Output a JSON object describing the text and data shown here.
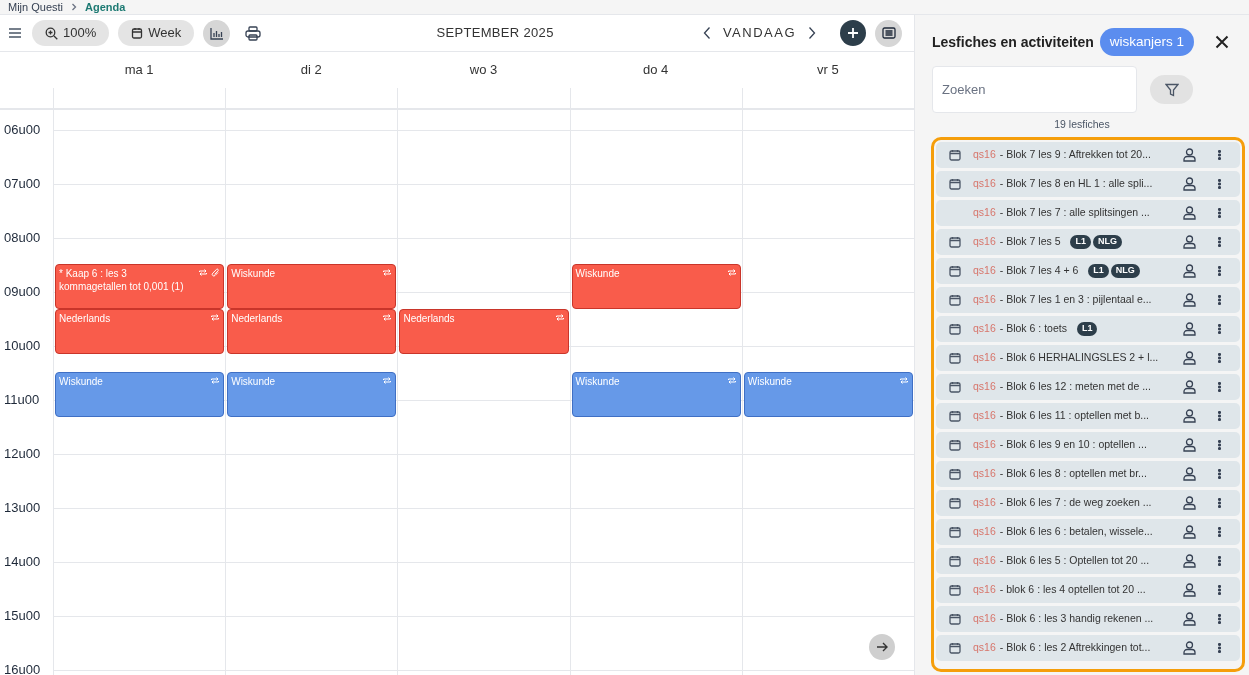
{
  "breadcrumb": [
    {
      "label": "Mijn Questi",
      "selected": false
    },
    {
      "label": "Agenda",
      "selected": true
    }
  ],
  "toolbar": {
    "zoom": "100%",
    "view": "Week",
    "title": "SEPTEMBER 2025",
    "today": "VANDAAG"
  },
  "hours": [
    "06u00",
    "07u00",
    "08u00",
    "09u00",
    "10u00",
    "11u00",
    "12u00",
    "13u00",
    "14u00",
    "15u00",
    "16u00"
  ],
  "days": [
    {
      "label": "ma 1",
      "events": [
        {
          "kind": "lesson",
          "lines": [
            "* Kaap 6 : les 3",
            "kommagetallen tot 0,001 (1)"
          ],
          "color": "#f95c4b",
          "recurring": true,
          "attachment": true
        },
        {
          "kind": "lesson",
          "lines": [
            "Nederlands"
          ],
          "color": "#f95c4b",
          "recurring": true
        },
        {
          "kind": "lesson",
          "lines": [
            "Wiskunde"
          ],
          "color": "#6699e8",
          "recurring": true
        }
      ]
    },
    {
      "label": "di 2",
      "events": [
        {
          "kind": "lesson",
          "lines": [
            "Wiskunde"
          ],
          "color": "#f95c4b",
          "recurring": true
        },
        {
          "kind": "lesson",
          "lines": [
            "Nederlands"
          ],
          "color": "#f95c4b",
          "recurring": true
        },
        {
          "kind": "lesson",
          "lines": [
            "Wiskunde"
          ],
          "color": "#6699e8",
          "recurring": true
        }
      ]
    },
    {
      "label": "wo 3",
      "events": [
        {
          "kind": "empty"
        },
        {
          "kind": "lesson",
          "lines": [
            "Nederlands"
          ],
          "color": "#f95c4b",
          "recurring": true
        }
      ]
    },
    {
      "label": "do 4",
      "events": [
        {
          "kind": "lesson",
          "lines": [
            "Wiskunde"
          ],
          "color": "#f95c4b",
          "recurring": true
        },
        {
          "kind": "empty"
        },
        {
          "kind": "lesson",
          "lines": [
            "Wiskunde"
          ],
          "color": "#6699e8",
          "recurring": true
        }
      ]
    },
    {
      "label": "vr 5",
      "events": [
        {
          "kind": "empty"
        },
        {
          "kind": "empty"
        },
        {
          "kind": "lesson",
          "lines": [
            "Wiskunde"
          ],
          "color": "#6699e8",
          "recurring": true
        }
      ]
    }
  ],
  "panel": {
    "title": "Lesfiches en activiteiten",
    "group": "wiskanjers 1",
    "search": {
      "placeholder": "Zoeken"
    },
    "count": "19 lesfiches",
    "items": [
      {
        "code": "qs16",
        "title": "- Blok 7 les 9 : Aftrekken tot 20...",
        "calendar": true
      },
      {
        "code": "qs16",
        "title": "- Blok 7 les 8 en HL 1 : alle spli...",
        "calendar": true
      },
      {
        "code": "qs16",
        "title": "- Blok 7 les 7 : alle splitsingen ...",
        "calendar": false
      },
      {
        "code": "qs16",
        "title": "- Blok 7 les 5",
        "calendar": true,
        "tags": [
          "L1",
          "NLG"
        ]
      },
      {
        "code": "qs16",
        "title": "- Blok 7 les 4 + 6",
        "calendar": true,
        "tags": [
          "L1",
          "NLG"
        ]
      },
      {
        "code": "qs16",
        "title": "- Blok 7 les 1 en 3 : pijlentaal e...",
        "calendar": true
      },
      {
        "code": "qs16",
        "title": "- Blok 6 : toets",
        "calendar": true,
        "tags": [
          "L1"
        ]
      },
      {
        "code": "qs16",
        "title": "- Blok 6 HERHALINGSLES 2 + l...",
        "calendar": true
      },
      {
        "code": "qs16",
        "title": "- Blok 6 les 12 : meten met de ...",
        "calendar": true
      },
      {
        "code": "qs16",
        "title": "- Blok 6 les 11 : optellen met b...",
        "calendar": true
      },
      {
        "code": "qs16",
        "title": "- Blok 6 les 9 en 10 : optellen ...",
        "calendar": true
      },
      {
        "code": "qs16",
        "title": "- Blok 6 les 8 : optellen met br...",
        "calendar": true
      },
      {
        "code": "qs16",
        "title": "- Blok 6 les 7 : de weg zoeken ...",
        "calendar": true
      },
      {
        "code": "qs16",
        "title": "- Blok 6 les 6 : betalen, wissele...",
        "calendar": true
      },
      {
        "code": "qs16",
        "title": "- Blok 6 les 5 : Optellen tot 20 ...",
        "calendar": true
      },
      {
        "code": "qs16",
        "title": "- blok 6 : les 4 optellen tot 20 ...",
        "calendar": true
      },
      {
        "code": "qs16",
        "title": "- Blok 6 : les 3 handig rekenen ...",
        "calendar": true
      },
      {
        "code": "qs16",
        "title": "- Blok 6 : les 2 Aftrekkingen tot...",
        "calendar": true
      }
    ]
  }
}
